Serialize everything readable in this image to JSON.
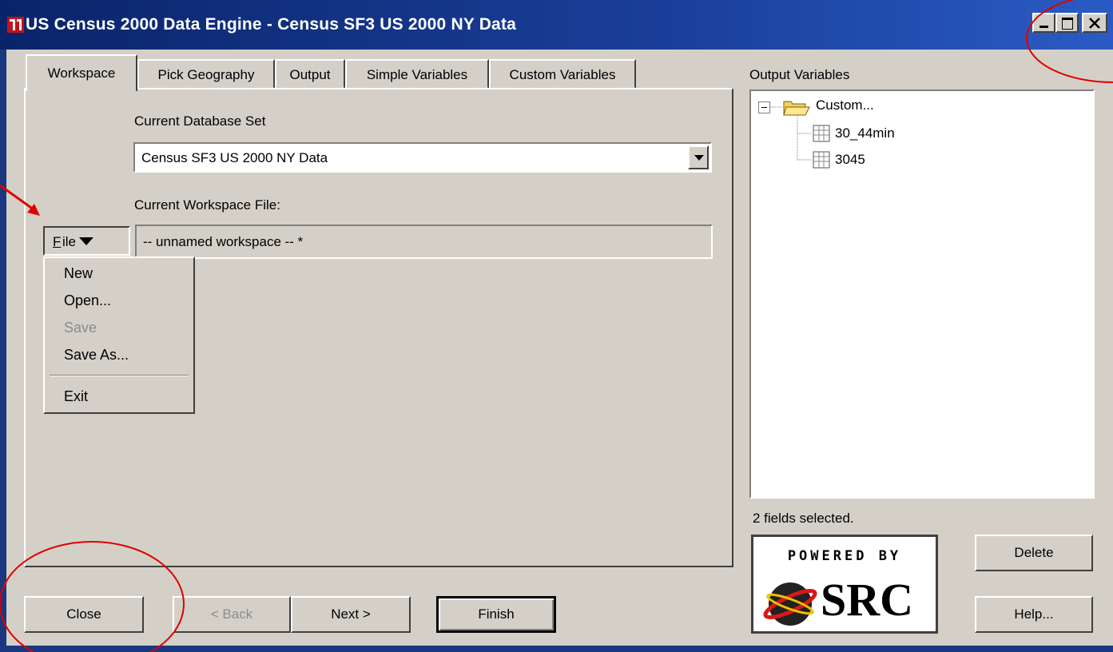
{
  "window": {
    "title": "US Census 2000 Data Engine - Census SF3 US 2000 NY Data",
    "controls": {
      "minimize": "_",
      "maximize": "□",
      "close": "×"
    }
  },
  "tabs": [
    {
      "label": "Workspace",
      "active": true
    },
    {
      "label": "Pick Geography",
      "active": false
    },
    {
      "label": "Output",
      "active": false
    },
    {
      "label": "Simple Variables",
      "active": false
    },
    {
      "label": "Custom Variables",
      "active": false
    }
  ],
  "workspace": {
    "database_label": "Current Database Set",
    "database_value": "Census SF3 US 2000 NY Data",
    "workspace_file_label": "Current Workspace File:",
    "workspace_file_value": "-- unnamed workspace -- *",
    "file_button_label": "File",
    "file_button_mnemonic": "F"
  },
  "file_menu": {
    "items": [
      {
        "label": "New",
        "enabled": true
      },
      {
        "label": "Open...",
        "enabled": true
      },
      {
        "label": "Save",
        "enabled": false
      },
      {
        "label": "Save As...",
        "enabled": true
      },
      {
        "label": "Exit",
        "enabled": true
      }
    ]
  },
  "output_variables": {
    "label": "Output Variables",
    "tree": {
      "folder": "Custom...",
      "children": [
        "30_44min",
        "3045"
      ]
    },
    "status": "2 fields selected."
  },
  "buttons": {
    "close": "Close",
    "back": "< Back",
    "next": "Next >",
    "finish": "Finish",
    "delete": "Delete",
    "help": "Help..."
  },
  "logo": {
    "powered_by": "POWERED BY",
    "brand": "SRC"
  },
  "colors": {
    "titlebar": "#0a246a",
    "face": "#d4d0c8",
    "annotation": "#e00000"
  }
}
